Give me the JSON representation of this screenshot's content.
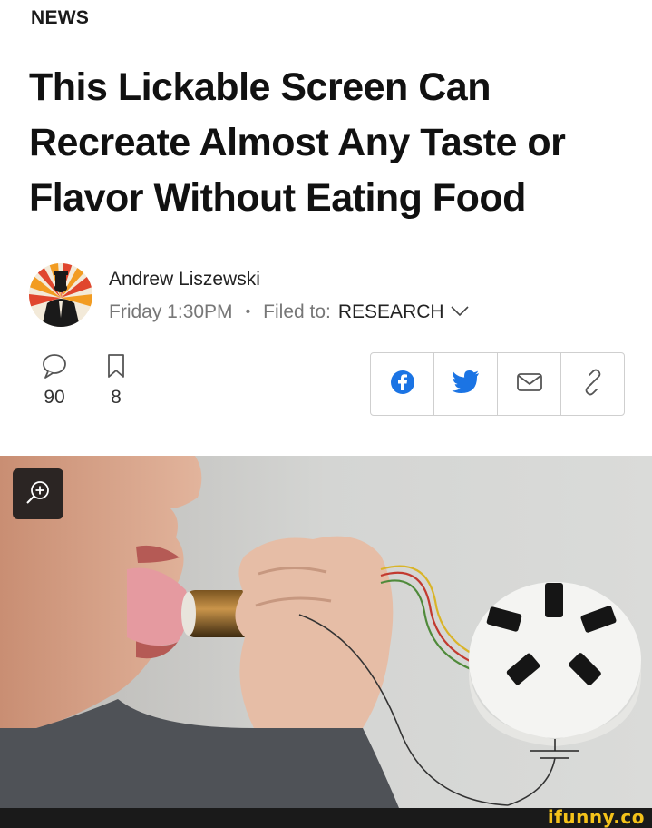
{
  "section": "NEWS",
  "headline": "This Lickable Screen Can Recreate Almost Any Taste or Flavor Without Eating Food",
  "author": {
    "name": "Andrew Liszewski",
    "date": "Friday 1:30PM",
    "separator": "•",
    "filed_label": "Filed to:",
    "category": "RESEARCH"
  },
  "stats": {
    "comments": {
      "icon": "comment-icon",
      "count": "90"
    },
    "bookmarks": {
      "icon": "bookmark-icon",
      "count": "8"
    }
  },
  "share": [
    {
      "icon": "facebook-icon",
      "color": "#1b74e4"
    },
    {
      "icon": "twitter-icon",
      "color": "#1b74e4"
    },
    {
      "icon": "email-icon",
      "color": "#555555"
    },
    {
      "icon": "link-icon",
      "color": "#555555"
    }
  ],
  "photo": {
    "zoom_icon": "zoom-in-icon"
  },
  "watermark": "ifunny.co",
  "colors": {
    "accent": "#1b74e4",
    "watermark": "#f4c21a"
  }
}
